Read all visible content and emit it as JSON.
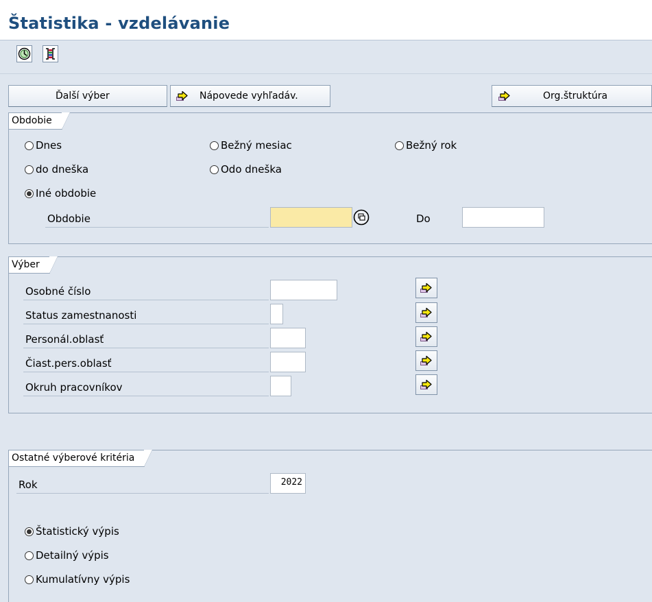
{
  "window": {
    "title": "Štatistika - vzdelávanie"
  },
  "toolbar": {
    "icons": [
      "execute-clock-icon",
      "color-columns-icon"
    ],
    "buttons": {
      "dalsi_vyber": "Ďalší výber",
      "napovede": "Nápovede vyhľadáv.",
      "org_struktura": "Org.štruktúra"
    }
  },
  "obdobie": {
    "tab_label": "Obdobie",
    "options": {
      "dnes": "Dnes",
      "bezny_mesiac": "Bežný mesiac",
      "bezny_rok": "Bežný rok",
      "do_dneska": "do dneška",
      "odo_dneska": "Odo dneška",
      "ine_obdobie": "Iné obdobie"
    },
    "selected": "ine_obdobie",
    "period_label": "Obdobie",
    "period_value": "",
    "to_label": "Do",
    "to_value": ""
  },
  "vyber": {
    "tab_label": "Výber",
    "fields": [
      {
        "label": "Osobné číslo",
        "value": ""
      },
      {
        "label": "Status zamestnanosti",
        "value": ""
      },
      {
        "label": "Personál.oblasť",
        "value": ""
      },
      {
        "label": "Čiast.pers.oblasť",
        "value": ""
      },
      {
        "label": "Okruh pracovníkov",
        "value": ""
      }
    ]
  },
  "ostatne": {
    "tab_label": "Ostatné výberové kritéria",
    "rok_label": "Rok",
    "rok_value": "2022",
    "options": {
      "statisticky": "Štatistický výpis",
      "detailny": "Detailný výpis",
      "kumulativny": "Kumulatívny výpis"
    },
    "selected": "statisticky"
  },
  "colors": {
    "title": "#1f4f7f",
    "background": "#dfe6ef",
    "required_field": "#faeaa6",
    "arrow": "#f7e70e"
  }
}
